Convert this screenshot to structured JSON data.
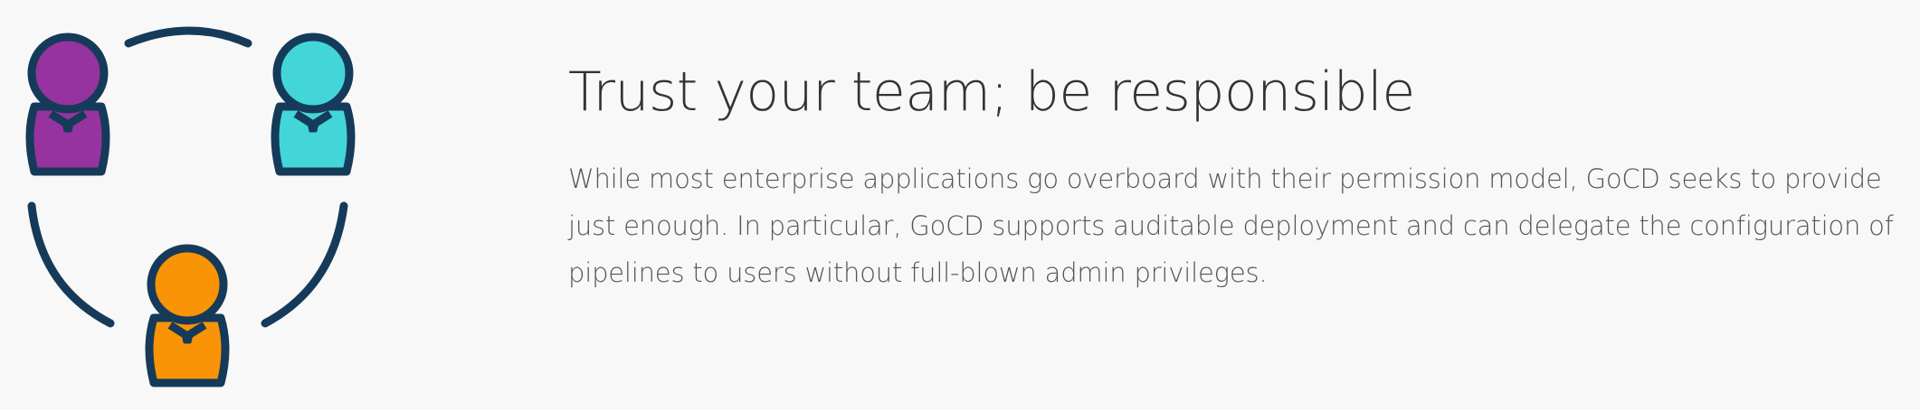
{
  "feature": {
    "title": "Trust your team; be responsible",
    "description": "While most enterprise applications go overboard with their permission model, GoCD seeks to provide just enough. In particular, GoCD supports auditable deployment and can delegate the configuration of pipelines to users without full-blown admin privileges."
  },
  "illustration": {
    "icon": "team-collaboration-icon",
    "colors": {
      "outline": "#163a59",
      "person_left": "#96339f",
      "person_right": "#42d6d9",
      "person_bottom": "#f89406",
      "background": "#f8f8f8"
    }
  }
}
